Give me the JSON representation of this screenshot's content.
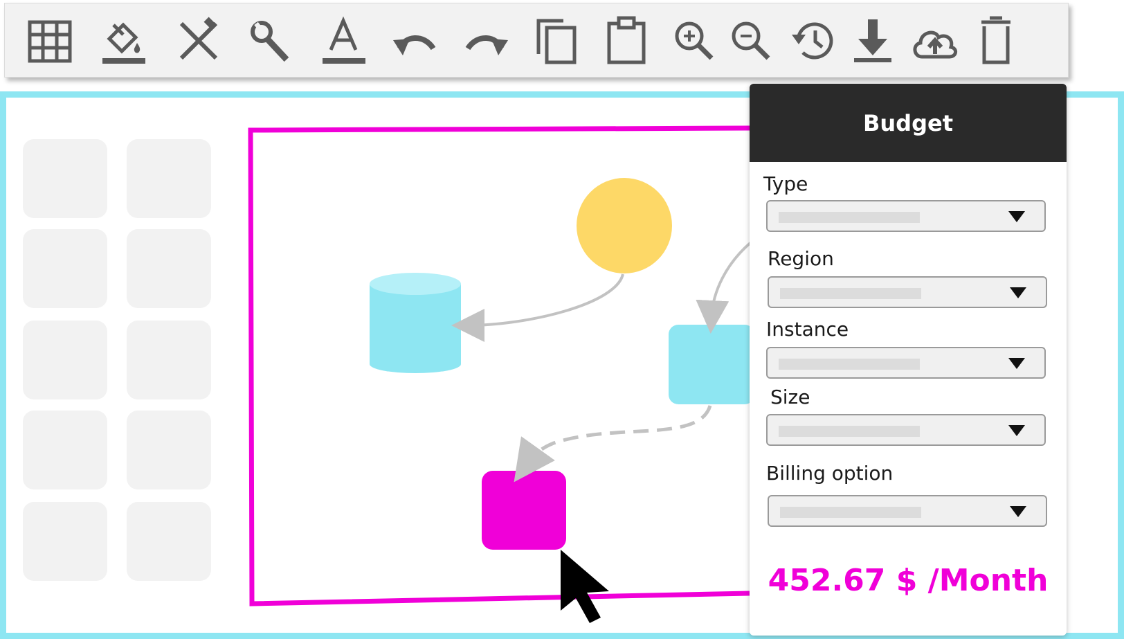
{
  "toolbar": {
    "tools": [
      {
        "icon": "table-icon"
      },
      {
        "icon": "fill-color-icon"
      },
      {
        "icon": "design-tools-icon"
      },
      {
        "icon": "wrench-icon"
      },
      {
        "icon": "text-color-icon",
        "label": "A"
      },
      {
        "icon": "undo-icon"
      },
      {
        "icon": "redo-icon"
      },
      {
        "icon": "copy-icon"
      },
      {
        "icon": "paste-icon"
      },
      {
        "icon": "zoom-in-icon"
      },
      {
        "icon": "zoom-out-icon"
      },
      {
        "icon": "history-icon"
      },
      {
        "icon": "download-icon"
      },
      {
        "icon": "cloud-upload-icon"
      },
      {
        "icon": "delete-icon"
      }
    ]
  },
  "panel": {
    "title": "Budget",
    "fields": [
      {
        "label": "Type"
      },
      {
        "label": "Region"
      },
      {
        "label": "Instance"
      },
      {
        "label": "Size"
      },
      {
        "label": "Billing option"
      }
    ],
    "price": "452.67 $ /Month"
  },
  "colors": {
    "accent": "#f000d8",
    "canvas_border": "#8ee6f2",
    "shape_blue": "#8ee6f2",
    "shape_yellow": "#fdd867",
    "header_bg": "#2a2a2a"
  }
}
